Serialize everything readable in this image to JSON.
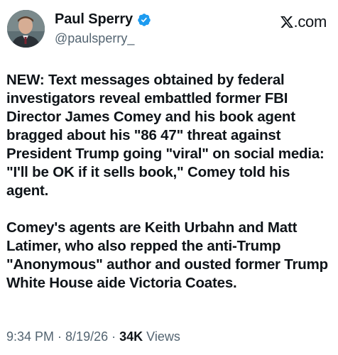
{
  "author": {
    "display_name": "Paul Sperry",
    "handle": "@paulsperry_",
    "verified": true
  },
  "brand": {
    "label": ".com",
    "logo_icon": "x-logo-icon"
  },
  "tweet": {
    "paragraphs": [
      "NEW: Text messages obtained by federal investigators reveal embattled former FBI Director James Comey and his book agent bragged about his \"86 47\" threat against President Trump going \"viral\" on social media: \"I'll be OK if it sells book,\" Comey told his agent.",
      "Comey's agents are Keith Urbahn and Matt Latimer, who also repped the anti-Trump \"Anonymous\" author and ousted former Trump White House aide Victoria Coates."
    ]
  },
  "meta": {
    "time": "9:34 PM",
    "separator": " · ",
    "date": "8/19/26",
    "views_count": "34K",
    "views_label": " Views"
  },
  "colors": {
    "text": "#0f1419",
    "secondary": "#536471",
    "verified": "#1d9bf0"
  }
}
